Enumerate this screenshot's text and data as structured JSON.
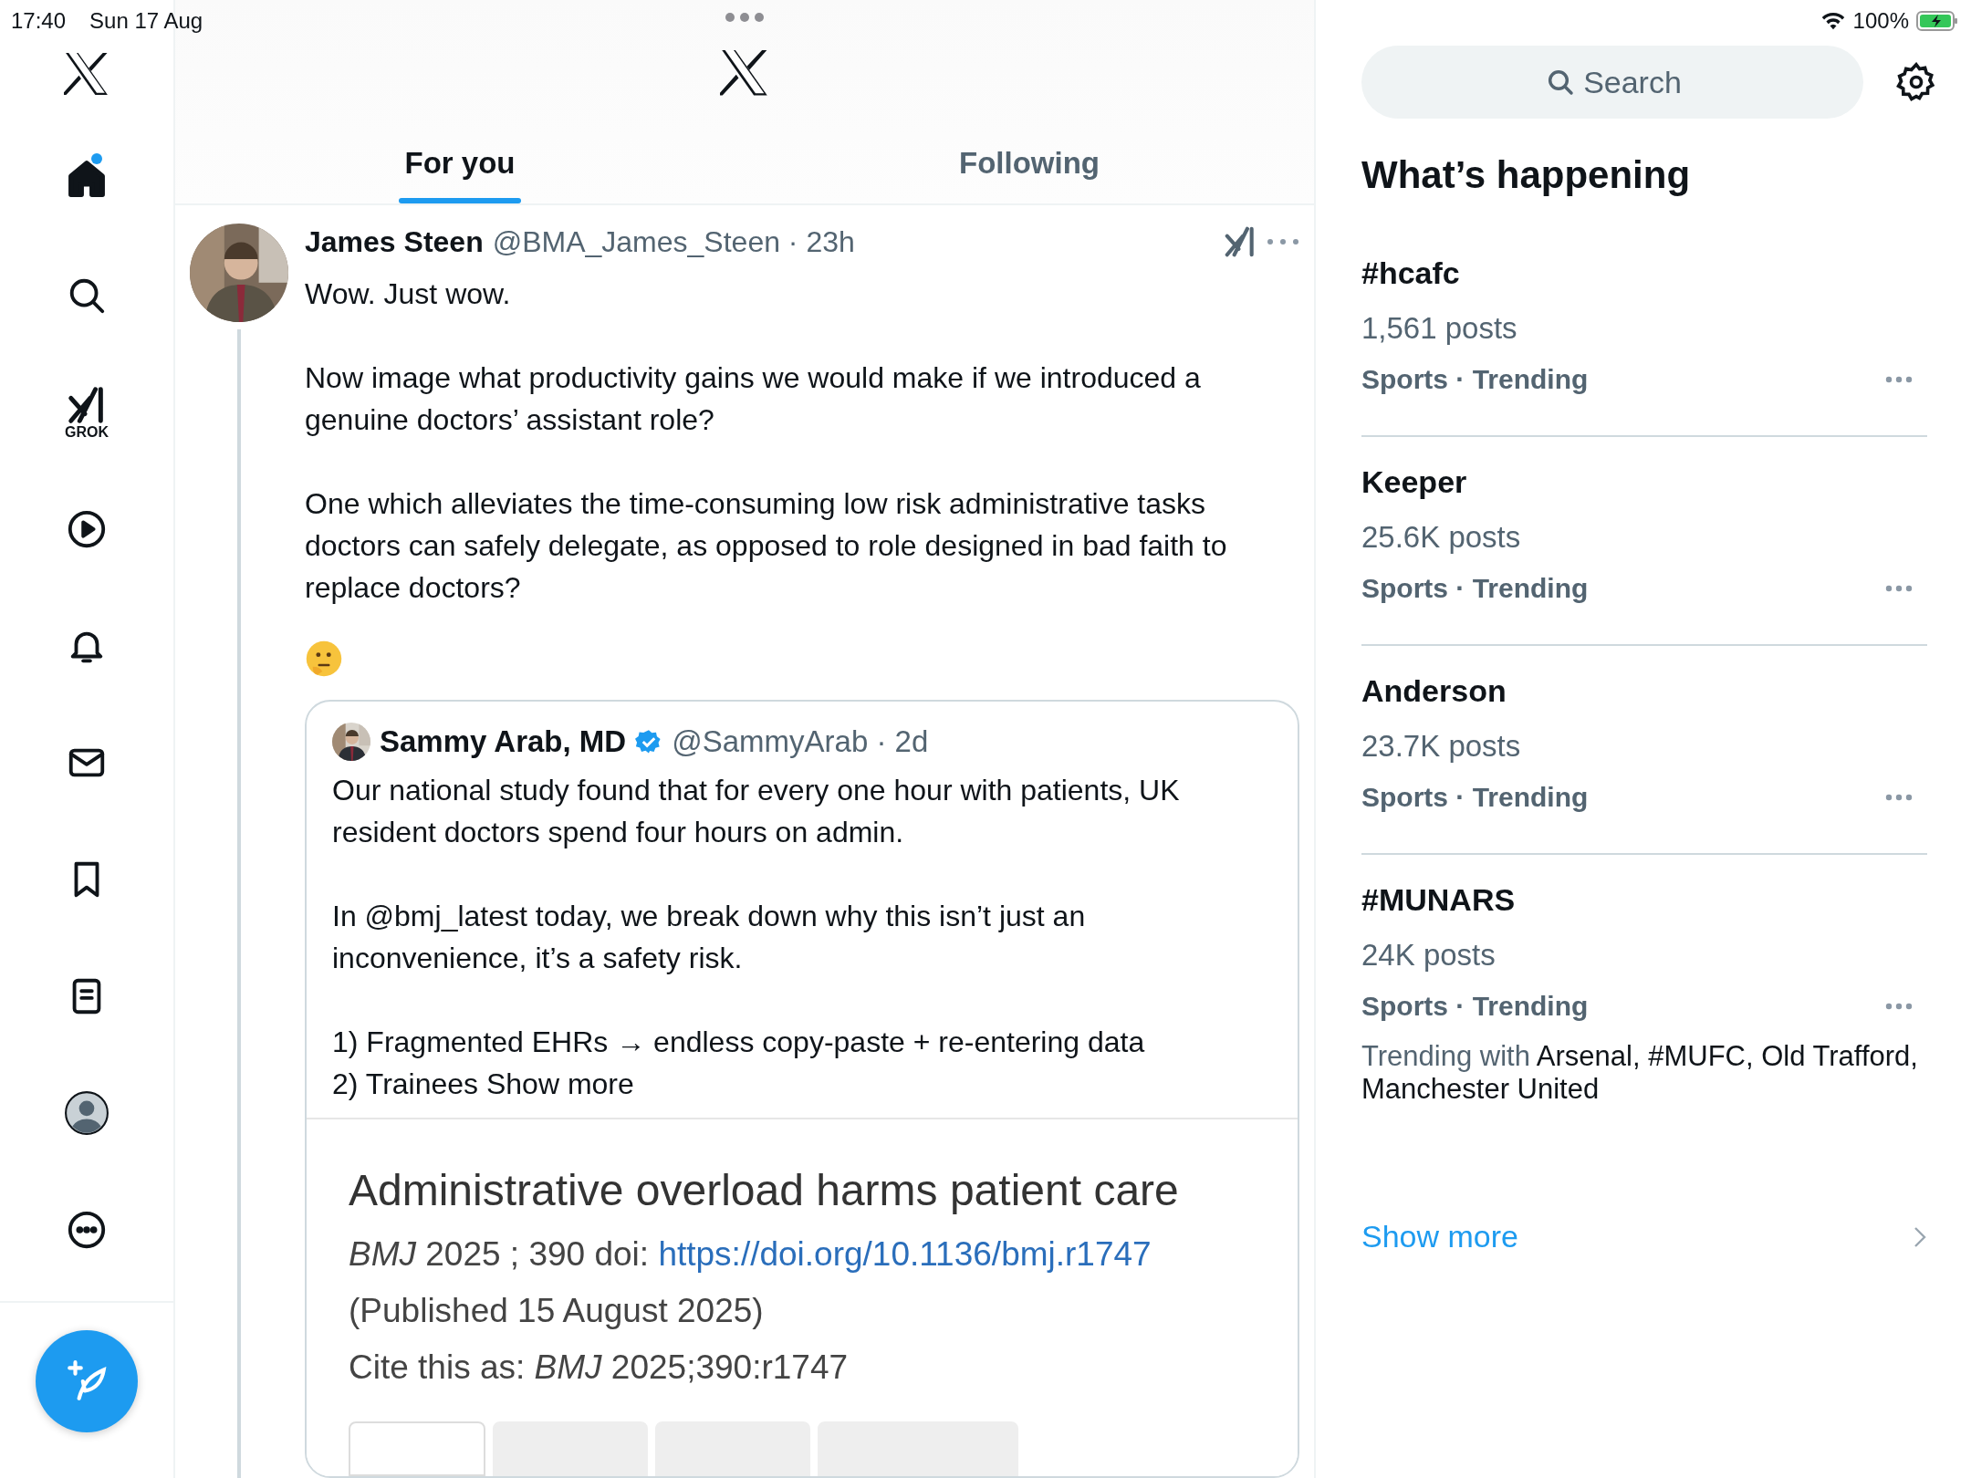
{
  "status_bar": {
    "time": "17:40",
    "date": "Sun 17 Aug",
    "battery": "100%"
  },
  "nav": {
    "items": [
      {
        "kind": "home",
        "selected": true,
        "badge": true
      },
      {
        "kind": "explore",
        "selected": false,
        "badge": false
      },
      {
        "kind": "grok",
        "selected": false,
        "badge": false,
        "label": "GROK"
      },
      {
        "kind": "video",
        "selected": false,
        "badge": false
      },
      {
        "kind": "notifications",
        "selected": false,
        "badge": false
      },
      {
        "kind": "messages",
        "selected": false,
        "badge": false
      },
      {
        "kind": "bookmarks",
        "selected": false,
        "badge": false
      },
      {
        "kind": "lists",
        "selected": false,
        "badge": false
      },
      {
        "kind": "profile",
        "selected": false,
        "badge": false
      },
      {
        "kind": "more",
        "selected": false,
        "badge": false
      }
    ]
  },
  "tabs": [
    {
      "label": "For you",
      "selected": true
    },
    {
      "label": "Following",
      "selected": false
    }
  ],
  "tweet": {
    "name": "James Steen",
    "handle": "@BMA_James_Steen · 23h",
    "paragraphs": [
      {
        "kind": "text",
        "text": "Wow. Just wow."
      },
      {
        "kind": "text",
        "text": "Now image what productivity gains we would make if we introduced a genuine doctors’ assistant role?"
      },
      {
        "kind": "text",
        "text": "One which alleviates the time-consuming low risk administrative tasks doctors can safely delegate, as opposed to role designed in bad faith to replace doctors?"
      },
      {
        "kind": "emoji"
      }
    ],
    "quote": {
      "name": "Sammy Arab, MD",
      "verified": true,
      "handle": "@SammyArab · 2d",
      "paragraphs": [
        "Our national study found that for every one hour with patients, UK resident doctors spend four hours on admin.",
        "In @bmj_latest today, we break down why this isn’t just an inconvenience, it’s a safety risk.",
        "1) Fragmented EHRs → endless copy-paste + re-entering data\n2) Trainees Show more"
      ],
      "article": {
        "title": "Administrative overload harms patient care",
        "citation": "*BMJ*  2025 ; 390  doi: ",
        "doi": "https://doi.org/10.1136/bmj.r1747",
        "published": "(Published 15 August 2025)",
        "cite": "Cite this as: *BMJ*  2025;390:r1747",
        "tabs": [
          {
            "selected": true
          },
          {
            "selected": false
          },
          {
            "selected": false
          },
          {
            "selected": false
          }
        ]
      }
    }
  },
  "sidebar": {
    "search": {
      "placeholder": "Search"
    },
    "heading": "What’s happening",
    "trends": [
      {
        "topic": "#hcafc",
        "count": "1,561 posts",
        "meta": "Sports · Trending"
      },
      {
        "topic": "Keeper",
        "count": "25.6K posts",
        "meta": "Sports · Trending"
      },
      {
        "topic": "Anderson",
        "count": "23.7K posts",
        "meta": "Sports · Trending"
      },
      {
        "topic": "#MUNARS",
        "count": "24K posts",
        "meta": "Sports · Trending",
        "trending_with_label": "Trending with",
        "trending_with": "Arsenal, #MUFC, Old Trafford, Manchester United"
      }
    ],
    "show_more": "Show more"
  }
}
